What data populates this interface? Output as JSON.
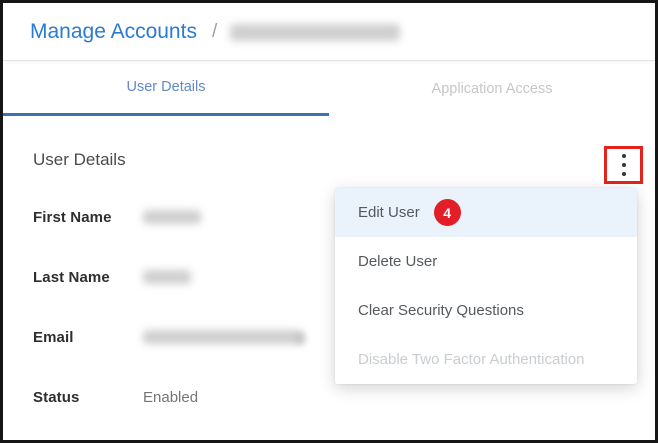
{
  "breadcrumb": {
    "root": "Manage Accounts",
    "separator": "/",
    "current_user_redacted": true
  },
  "tabs": [
    {
      "label": "User Details",
      "active": true
    },
    {
      "label": "Application Access",
      "active": false
    }
  ],
  "section": {
    "title": "User Details"
  },
  "fields": [
    {
      "label": "First Name",
      "value": "",
      "redacted": true
    },
    {
      "label": "Last Name",
      "value": "",
      "redacted": true
    },
    {
      "label": "Email",
      "value": "",
      "redacted": true
    },
    {
      "label": "Status",
      "value": "Enabled",
      "redacted": false
    }
  ],
  "menu": {
    "items": [
      {
        "label": "Edit User",
        "highlighted": true,
        "badge": "4",
        "disabled": false
      },
      {
        "label": "Delete User",
        "highlighted": false,
        "disabled": false
      },
      {
        "label": "Clear Security Questions",
        "highlighted": false,
        "disabled": false
      },
      {
        "label": "Disable Two Factor Authentication",
        "highlighted": false,
        "disabled": true
      }
    ]
  },
  "icons": {
    "kebab_menu": "vertical-ellipsis"
  },
  "colors": {
    "link_blue": "#2b7ad3",
    "tab_active_text": "#6189c6",
    "tab_underline": "#3d72b8",
    "menu_highlight_bg": "#eaf3fb",
    "annotation_red": "#e3231d",
    "badge_red": "#e41e26",
    "status_text": "#757575"
  }
}
